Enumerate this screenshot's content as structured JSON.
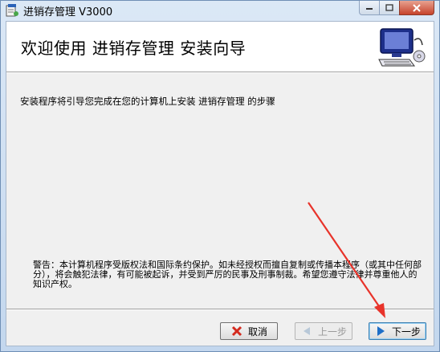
{
  "window": {
    "title": "进销存管理 V3000"
  },
  "header": {
    "title": "欢迎使用 进销存管理 安装向导"
  },
  "body": {
    "intro": "安装程序将引导您完成在您的计算机上安装 进销存管理 的步骤",
    "warning": "警告：本计算机程序受版权法和国际条约保护。如未经授权而擅自复制或传播本程序（或其中任何部分），将会触犯法律，有可能被起诉，并受到严厉的民事及刑事制裁。希望您遵守法律并尊重他人的知识产权。"
  },
  "buttons": {
    "cancel": "取消",
    "back": "上一步",
    "next": "下一步"
  },
  "colors": {
    "annotation_arrow": "#e8332a",
    "next_icon": "#1e6fc8",
    "cancel_icon": "#d42a1e"
  }
}
